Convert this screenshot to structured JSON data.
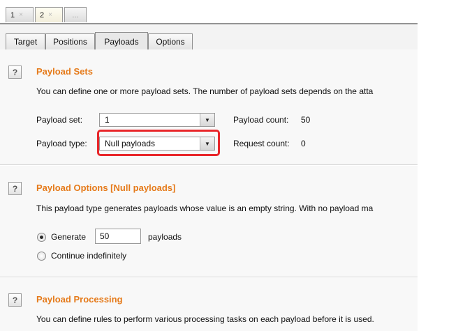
{
  "tabs": {
    "numbered": [
      {
        "label": "1",
        "close": "×"
      },
      {
        "label": "2",
        "close": "×"
      },
      {
        "label": "..."
      }
    ]
  },
  "subtabs": [
    "Target",
    "Positions",
    "Payloads",
    "Options"
  ],
  "payload_sets": {
    "help": "?",
    "title": "Payload Sets",
    "description": "You can define one or more payload sets. The number of payload sets depends on the atta",
    "set_label": "Payload set:",
    "set_value": "1",
    "count_label": "Payload count:",
    "count_value": "50",
    "type_label": "Payload type:",
    "type_value": "Null payloads",
    "request_label": "Request count:",
    "request_value": "0"
  },
  "payload_options": {
    "help": "?",
    "title": "Payload Options [Null payloads]",
    "description": "This payload type generates payloads whose value is an empty string. With no payload ma",
    "generate_label": "Generate",
    "generate_value": "50",
    "generate_suffix": "payloads",
    "continue_label": "Continue indefinitely"
  },
  "payload_processing": {
    "help": "?",
    "title": "Payload Processing",
    "description": "You can define rules to perform various processing tasks on each payload before it is used."
  },
  "icons": {
    "dropdown": "▼"
  },
  "colors": {
    "section_title": "#e57a1a",
    "highlight": "#e8262a"
  }
}
